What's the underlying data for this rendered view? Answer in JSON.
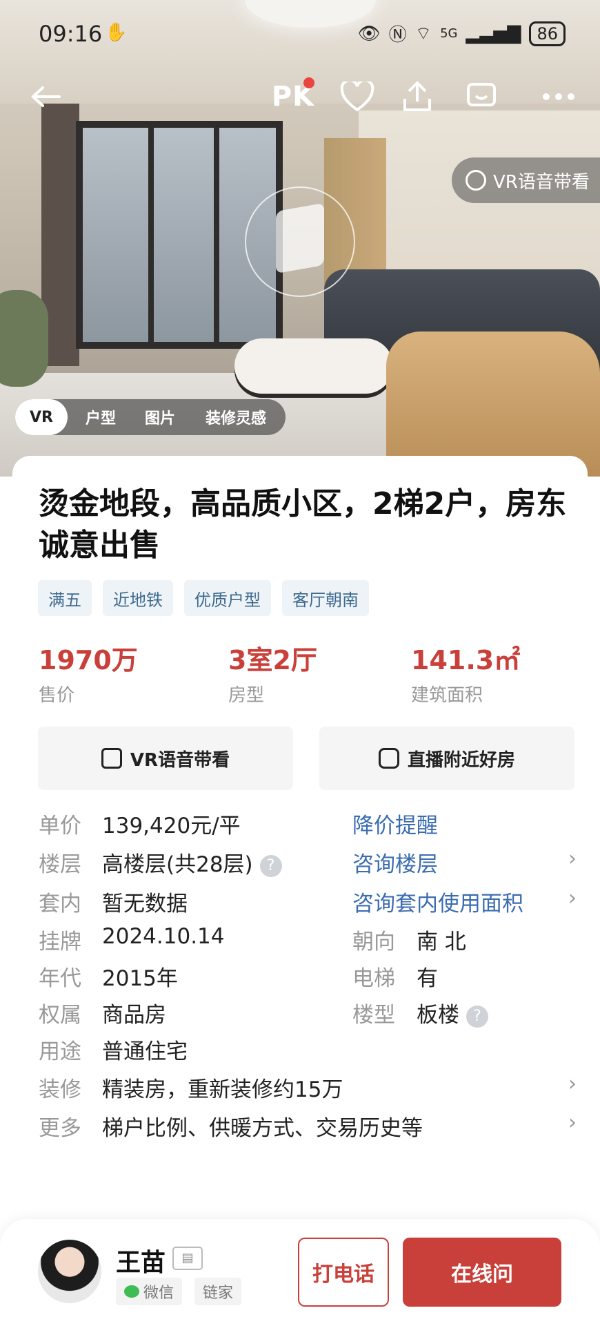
{
  "status_bar": {
    "time": "09:16",
    "network": "5G",
    "battery": "86"
  },
  "header": {
    "pk_label": "PK"
  },
  "hero": {
    "vr_guide_label": "VR语音带看",
    "media_tabs": [
      {
        "label": "VR",
        "active": true
      },
      {
        "label": "户型",
        "active": false
      },
      {
        "label": "图片",
        "active": false
      },
      {
        "label": "装修灵感",
        "active": false
      }
    ]
  },
  "listing": {
    "title": "烫金地段，高品质小区，2梯2户，房东诚意出售",
    "tags": [
      "满五",
      "近地铁",
      "优质户型",
      "客厅朝南"
    ],
    "metrics": [
      {
        "value": "1970万",
        "label": "售价"
      },
      {
        "value": "3室2厅",
        "label": "房型"
      },
      {
        "value": "141.3㎡",
        "label": "建筑面积"
      }
    ],
    "actions": [
      {
        "label": "VR语音带看"
      },
      {
        "label": "直播附近好房"
      }
    ]
  },
  "details": {
    "unit_price": {
      "key": "单价",
      "value": "139,420元/平",
      "link": "降价提醒"
    },
    "floor": {
      "key": "楼层",
      "value": "高楼层(共28层)",
      "link": "咨询楼层"
    },
    "inner": {
      "key": "套内",
      "value": "暂无数据",
      "link": "咨询套内使用面积"
    },
    "listed": {
      "key": "挂牌",
      "value": "2024.10.14",
      "key2": "朝向",
      "value2": "南 北"
    },
    "era": {
      "key": "年代",
      "value": "2015年",
      "key2": "电梯",
      "value2": "有"
    },
    "ownership": {
      "key": "权属",
      "value": "商品房",
      "key2": "楼型",
      "value2": "板楼"
    },
    "usage": {
      "key": "用途",
      "value": "普通住宅"
    },
    "decoration": {
      "key": "装修",
      "value": "精装房，重新装修约15万"
    },
    "more": {
      "key": "更多",
      "value": "梯户比例、供暖方式、交易历史等"
    }
  },
  "agent": {
    "name": "王苗",
    "badge_wechat": "微信",
    "badge_brand": "链家",
    "call_label": "打电话",
    "chat_label": "在线问"
  },
  "colors": {
    "accent_red": "#c9403a",
    "link_blue": "#3c6db0",
    "tag_bg": "#eef3f7"
  }
}
